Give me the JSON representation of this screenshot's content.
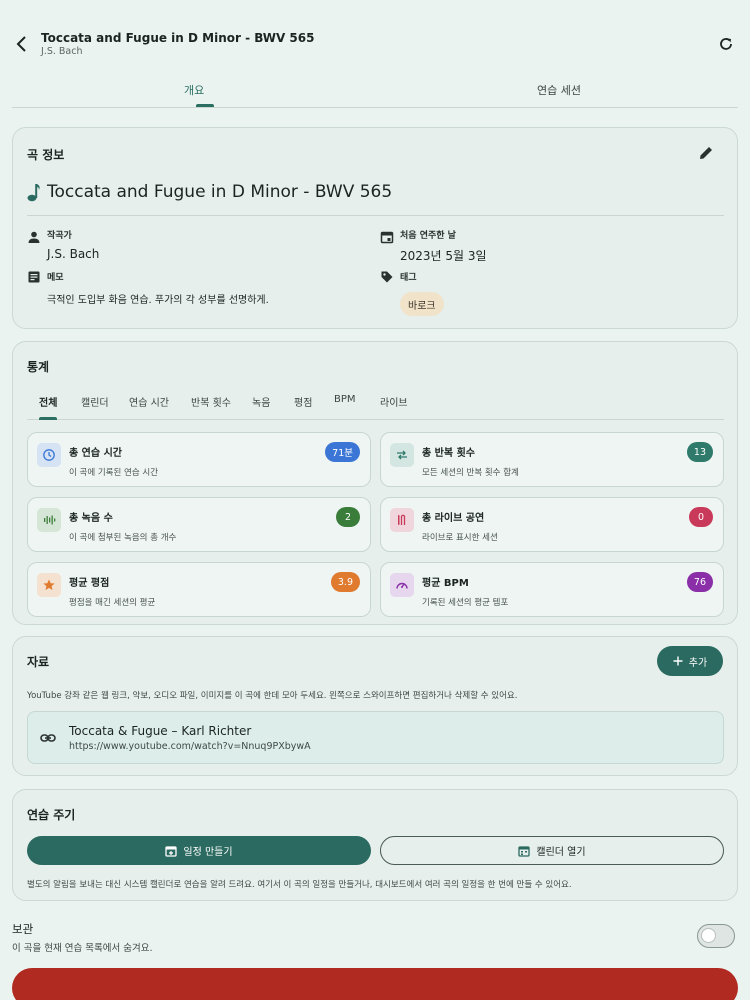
{
  "header": {
    "title": "Toccata and Fugue in D Minor - BWV 565",
    "subtitle": "J.S. Bach"
  },
  "tabs": [
    {
      "label": "개요",
      "active": true
    },
    {
      "label": "연습 세션",
      "active": false
    }
  ],
  "song_info": {
    "section_title": "곡 정보",
    "name": "Toccata and Fugue in D Minor - BWV 565",
    "composer_label": "작곡가",
    "composer": "J.S. Bach",
    "first_played_label": "처음 연주한 날",
    "first_played": "2023년 5월 3일",
    "memo_label": "메모",
    "memo": "극적인 도입부 화음 연습. 푸가의 각 성부를 선명하게.",
    "tags_label": "태그",
    "tags": [
      "바로크"
    ]
  },
  "stats": {
    "section_title": "통계",
    "tabs": [
      "전체",
      "캘린더",
      "연습 시간",
      "반복 횟수",
      "녹음",
      "평점",
      "BPM",
      "라이브"
    ],
    "active_tab": "전체",
    "boxes": [
      {
        "title": "총 연습 시간",
        "sub": "이 곡에 기록된 연습 시간",
        "value": "71분",
        "color": "#3b76d6",
        "icon": "clock-icon"
      },
      {
        "title": "총 반복 횟수",
        "sub": "모든 세션의 반복 횟수 합계",
        "value": "13",
        "color": "#2f7a6b",
        "icon": "repeat-icon"
      },
      {
        "title": "총 녹음 수",
        "sub": "이 곡에 첨부된 녹음의 총 개수",
        "value": "2",
        "color": "#3a7d3a",
        "icon": "waveform-icon"
      },
      {
        "title": "총 라이브 공연",
        "sub": "라이브로 표시한 세션",
        "value": "0",
        "color": "#c93a5a",
        "icon": "live-icon"
      },
      {
        "title": "평균 평점",
        "sub": "평점을 매긴 세션의 평균",
        "value": "3.9",
        "color": "#e07a2e",
        "icon": "star-icon"
      },
      {
        "title": "평균 BPM",
        "sub": "기록된 세션의 평균 템포",
        "value": "76",
        "color": "#8a2fa8",
        "icon": "speedometer-icon"
      }
    ]
  },
  "resources": {
    "section_title": "자료",
    "add_label": "추가",
    "description": "YouTube 강좌 같은 웹 링크, 악보, 오디오 파일, 이미지를 이 곡에 한데 모아 두세요. 왼쪽으로 스와이프하면 편집하거나 삭제할 수 있어요.",
    "items": [
      {
        "title": "Toccata & Fugue – Karl Richter",
        "url": "https://www.youtube.com/watch?v=Nnuq9PXbywA"
      }
    ]
  },
  "practice_cycle": {
    "section_title": "연습 주기",
    "make_schedule_label": "일정 만들기",
    "open_calendar_label": "캘린더 열기",
    "description": "별도의 알림을 보내는 대신 시스템 캘린더로 연습을 알려 드려요. 여기서 이 곡의 일정을 만들거나, 대시보드에서 여러 곡의 일정을 한 번에 만들 수 있어요."
  },
  "archive": {
    "title": "보관",
    "description": "이 곡을 현재 연습 목록에서 숨겨요.",
    "enabled": false
  }
}
